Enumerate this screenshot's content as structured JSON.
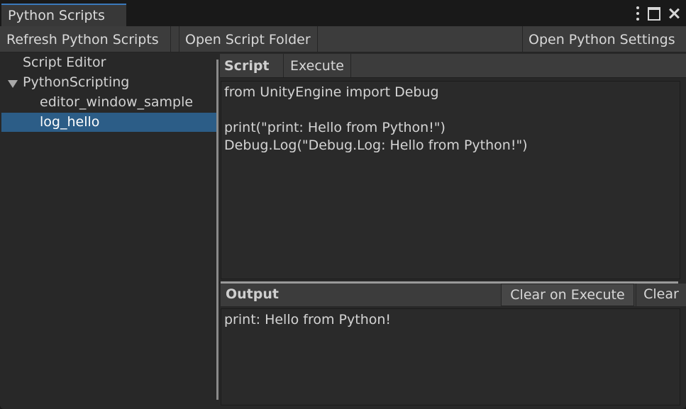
{
  "window": {
    "tab_title": "Python Scripts"
  },
  "toolbar": {
    "refresh_label": "Refresh Python Scripts",
    "open_folder_label": "Open Script Folder",
    "open_settings_label": "Open Python Settings"
  },
  "tree": {
    "items": [
      {
        "label": "Script Editor",
        "expandable": false,
        "selected": false
      },
      {
        "label": "PythonScripting",
        "expandable": true,
        "expanded": true,
        "selected": false
      },
      {
        "label": "editor_window_sample",
        "expandable": false,
        "selected": false
      },
      {
        "label": "log_hello",
        "expandable": false,
        "selected": true
      }
    ]
  },
  "script": {
    "header_label": "Script",
    "execute_label": "Execute",
    "code": "from UnityEngine import Debug\n\nprint(\"print: Hello from Python!\")\nDebug.Log(\"Debug.Log: Hello from Python!\")"
  },
  "output": {
    "header_label": "Output",
    "clear_on_execute_label": "Clear on Execute",
    "clear_label": "Clear",
    "text": "print: Hello from Python!"
  },
  "colors": {
    "accent": "#3a79bb",
    "selection": "#2c5d87"
  }
}
